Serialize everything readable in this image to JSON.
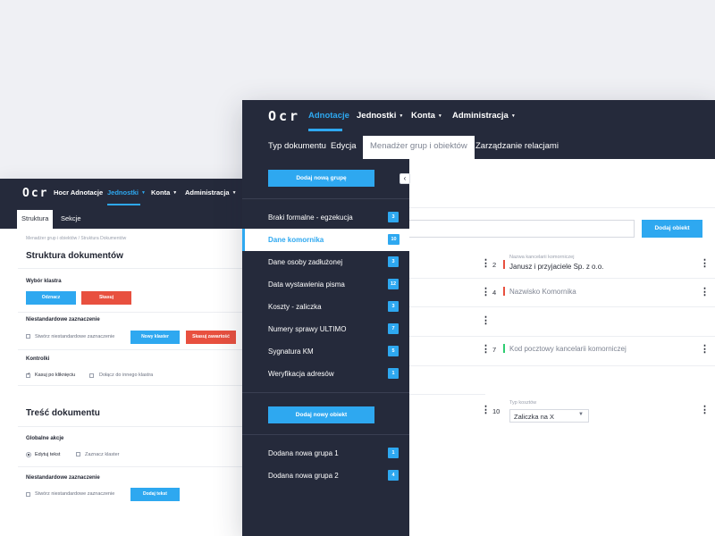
{
  "back_window": {
    "logo": "Ocr",
    "nav": [
      {
        "label": "Hocr Adnotacje",
        "caret": ""
      },
      {
        "label": "Jednostki",
        "caret": "▼"
      },
      {
        "label": "Konta",
        "caret": "▼"
      },
      {
        "label": "Administracja",
        "caret": "▼"
      }
    ],
    "tabs": [
      "Struktura",
      "Sekcje"
    ],
    "breadcrumb": "Menadżer grup i obiektów / Struktura Dokumentów",
    "section1": {
      "title": "Struktura dokumentów",
      "cluster_label": "Wybór klastra",
      "mark_button": "Odznacz",
      "delete_button": "Skasuj",
      "nonstandard_label": "Niestandardowe zaznaczenie",
      "create_nonstandard": "Stwórz niestandardowe zaznaczenie",
      "new_cluster_button": "Nowy klaster",
      "delete_content_button": "Skasuj zawartość",
      "controls_label": "Kontrolki",
      "delete_on_click": "Kasuj po kliknięciu",
      "attach_to_cluster": "Dołącz do innego klastra"
    },
    "section2": {
      "title": "Treść dokumentu",
      "global_label": "Globalne akcje",
      "edit_text": "Edytuj tekst",
      "mark_cluster": "Zaznacz klaster",
      "nonstandard_label": "Niestandardowe zaznaczenie",
      "create_nonstandard": "Stwórz niestandardowe zaznaczenie",
      "add_text_button": "Dodaj tekst"
    }
  },
  "front_window": {
    "logo": "Ocr",
    "nav": [
      {
        "label": "Adnotacje",
        "caret": ""
      },
      {
        "label": "Jednostki",
        "caret": "▼"
      },
      {
        "label": "Konta",
        "caret": "▼"
      },
      {
        "label": "Administracja",
        "caret": "▼"
      }
    ],
    "tabs": [
      "Typ dokumentu",
      "Edycja",
      "Menadżer  grup i obiektów",
      "Zarządzanie relacjami"
    ],
    "sidebar": {
      "add_group_button": "Dodaj nową grupę",
      "groups": [
        {
          "label": "Braki formalne - egzekucja",
          "count": "3"
        },
        {
          "label": "Dane komornika",
          "count": "10"
        },
        {
          "label": "Dane osoby zadłużonej",
          "count": "3"
        },
        {
          "label": "Data wystawienia pisma",
          "count": "12"
        },
        {
          "label": "Koszty  - zaliczka",
          "count": "3"
        },
        {
          "label": "Numery sprawy ULTIMO",
          "count": "7"
        },
        {
          "label": "Sygnatura KM",
          "count": "5"
        },
        {
          "label": "Weryfikacja adresów",
          "count": "1"
        }
      ],
      "add_object_button": "Dodaj nowy obiekt",
      "new_groups": [
        {
          "label": "Dodana nowa grupa 1",
          "count": "1"
        },
        {
          "label": "Dodana nowa grupa 2",
          "count": "4"
        }
      ],
      "collapse_glyph": "‹"
    },
    "add_object_button": "Dodaj obiekt",
    "menu_glyph": "⋮",
    "objects": [
      {
        "num": "2",
        "caption": "Nazwa kancelarii komorniczej",
        "value": "Janusz i przyjaciele  Sp. z o.o.",
        "mark": "#e8503f"
      },
      {
        "num": "4",
        "caption": "",
        "value": "Nazwisko Komornika",
        "mark": "#e8503f"
      },
      {
        "num": "7",
        "caption": "",
        "value": "Kod pocztowy kancelarii komorniczej",
        "mark": "#2ecc71"
      },
      {
        "num": "10",
        "caption": "Typ kosztów",
        "value": "Zaliczka na X",
        "mark": ""
      }
    ]
  },
  "colors": {
    "accent": "#2ea8f0",
    "danger": "#e8503f",
    "success": "#2ecc71",
    "navbar": "#252a3b"
  }
}
